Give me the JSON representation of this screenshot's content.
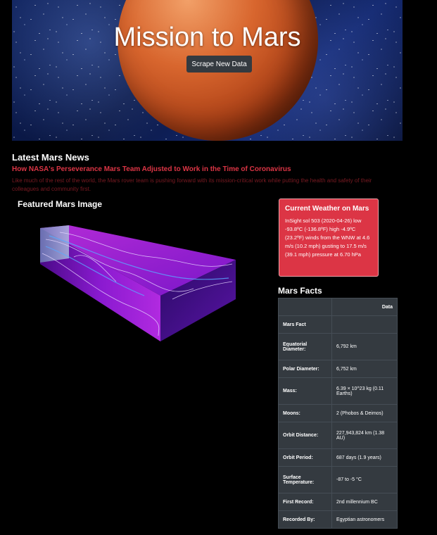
{
  "hero": {
    "title": "Mission to Mars",
    "button_label": "Scrape New Data"
  },
  "news": {
    "heading": "Latest Mars News",
    "title": "How NASA's Perseverance Mars Team Adjusted to Work in the Time of Coronavirus",
    "teaser": "Like much of the rest of the world, the Mars rover team is pushing forward with its mission-critical work while putting the health and safety of their colleagues and community first."
  },
  "featured": {
    "heading": "Featured Mars Image"
  },
  "weather": {
    "title": "Current Weather on Mars",
    "text": "InSight sol 503 (2020-04-26) low -93.8ºC (-136.8ºF) high -4.9ºC (23.2ºF) winds from the WNW at 4.6 m/s (10.2 mph) gusting to 17.5 m/s (39.1 mph) pressure at 6.70 hPa"
  },
  "facts": {
    "heading": "Mars Facts",
    "header": {
      "label": "",
      "value": "Data"
    },
    "rows": [
      {
        "label": "Mars Fact",
        "value": ""
      },
      {
        "label": "Equatorial Diameter:",
        "value": "6,792 km"
      },
      {
        "label": "Polar Diameter:",
        "value": "6,752 km"
      },
      {
        "label": "Mass:",
        "value": "6.39 × 10^23 kg (0.11 Earths)"
      },
      {
        "label": "Moons:",
        "value": "2 (Phobos & Deimos)"
      },
      {
        "label": "Orbit Distance:",
        "value": "227,943,824 km (1.38 AU)"
      },
      {
        "label": "Orbit Period:",
        "value": "687 days (1.9 years)"
      },
      {
        "label": "Surface Temperature:",
        "value": "-87 to -5 °C"
      },
      {
        "label": "First Record:",
        "value": "2nd millennium BC"
      },
      {
        "label": "Recorded By:",
        "value": "Egyptian astronomers"
      }
    ]
  },
  "colors": {
    "accent_red": "#dc3545",
    "table_dark": "#343a40",
    "button_dark": "#343a40"
  }
}
